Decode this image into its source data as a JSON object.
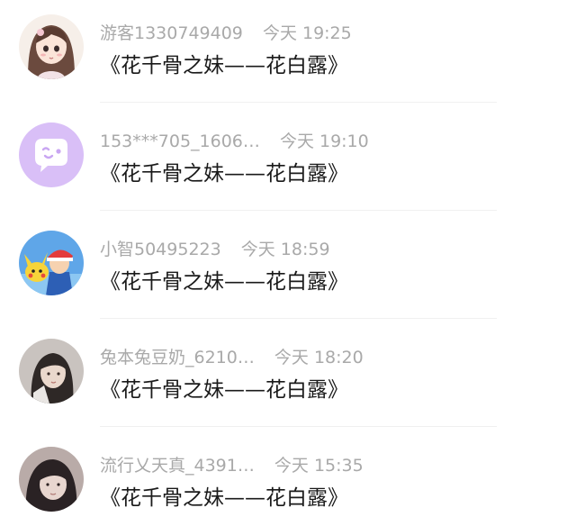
{
  "comments": [
    {
      "username": "游客1330749409",
      "time": "今天 19:25",
      "text": "《花千骨之妹——花白露》",
      "avatar": {
        "icon": "anime-girl-avatar-icon",
        "bg": "#f6efe9"
      }
    },
    {
      "username": "153***705_1606…",
      "time": "今天 19:10",
      "text": "《花千骨之妹——花白露》",
      "avatar": {
        "icon": "chat-bubble-avatar-icon",
        "bg": "#d9bff7"
      }
    },
    {
      "username": "小智50495223",
      "time": "今天 18:59",
      "text": "《花千骨之妹——花白露》",
      "avatar": {
        "icon": "cartoon-trainer-avatar-icon",
        "bg": "#5fa6e8"
      }
    },
    {
      "username": "兔本兔豆奶_6210…",
      "time": "今天 18:20",
      "text": "《花千骨之妹——花白露》",
      "avatar": {
        "icon": "photo-girl-avatar-icon",
        "bg": "#c9c3bf"
      }
    },
    {
      "username": "流行乂天真_4391…",
      "time": "今天 15:35",
      "text": "《花千骨之妹——花白露》",
      "avatar": {
        "icon": "photo-woman-avatar-icon",
        "bg": "#b9aba8"
      }
    }
  ]
}
